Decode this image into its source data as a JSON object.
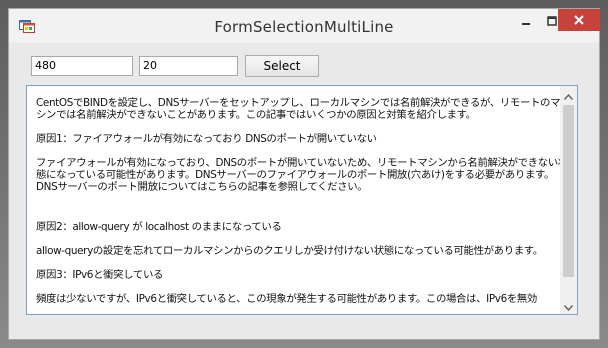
{
  "window": {
    "title": "FormSelectionMultiLine",
    "icons": {
      "app": "window-app-icon",
      "minimize": "minimize-icon",
      "maximize": "maximize-icon",
      "close": "close-icon"
    },
    "close_button_color": "#c7423a"
  },
  "form": {
    "input1_value": "480",
    "input2_value": "20",
    "select_label": "Select"
  },
  "textbox": {
    "lines": [
      "CentOSでBINDを設定し、DNSサーバーをセットアップし、ローカルマシンでは名前解決ができるが、リモートのマ",
      "シンでは名前解決ができないことがあります。この記事ではいくつかの原因と対策を紹介します。",
      "原因1：ファイアウォールが有効になっており DNSのポートが開いていない",
      "ファイアウォールが有効になっており、DNSのポートが開いていないため、リモートマシンから名前解決ができない状",
      "態になっている可能性があります。DNSサーバーのファイアウォールのポート開放(穴あけ)をする必要があります。",
      "DNSサーバーのポート開放についてはこちらの記事を参照してください。",
      "原因2：allow-query が localhost のままになっている",
      "allow-queryの設定を忘れてローカルマシンからのクエリしか受け付けない状態になっている可能性があります。",
      "原因3：IPv6と衝突している",
      "頻度は少ないですが、IPv6と衝突していると、この現象が発生する可能性があります。この場合は、IPv6を無効"
    ]
  },
  "scrollbar": {
    "up_icon": "scroll-up-arrow-icon",
    "down_icon": "scroll-down-arrow-icon"
  }
}
